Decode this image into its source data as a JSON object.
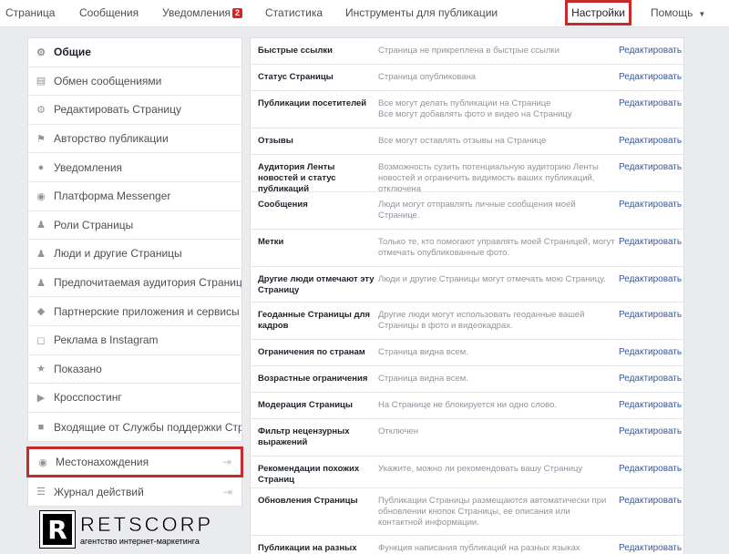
{
  "topbar": {
    "page": "Страница",
    "messages": "Сообщения",
    "notifications": "Уведомления",
    "notifications_count": "2",
    "stats": "Статистика",
    "tools": "Инструменты для публикации",
    "settings": "Настройки",
    "help": "Помощь"
  },
  "left_menu": [
    {
      "label": "Общие",
      "icon": "gear-icon"
    },
    {
      "label": "Обмен сообщениями",
      "icon": "messages-icon"
    },
    {
      "label": "Редактировать Страницу",
      "icon": "gear-icon"
    },
    {
      "label": "Авторство публикации",
      "icon": "flag-icon"
    },
    {
      "label": "Уведомления",
      "icon": "globe-icon"
    },
    {
      "label": "Платформа Messenger",
      "icon": "messenger-icon"
    },
    {
      "label": "Роли Страницы",
      "icon": "person-icon"
    },
    {
      "label": "Люди и другие Страницы",
      "icon": "people-icon"
    },
    {
      "label": "Предпочитаемая аудитория Страницы",
      "icon": "people-icon"
    },
    {
      "label": "Партнерские приложения и сервисы",
      "icon": "cube-icon"
    },
    {
      "label": "Реклама в Instagram",
      "icon": "instagram-icon"
    },
    {
      "label": "Показано",
      "icon": "star-icon"
    },
    {
      "label": "Кросспостинг",
      "icon": "video-icon"
    },
    {
      "label": "Входящие от Службы поддержки Страни",
      "icon": "facebook-icon"
    }
  ],
  "left_menu2": [
    {
      "label": "Местонахождения",
      "icon": "pin-icon"
    },
    {
      "label": "Журнал действий",
      "icon": "list-icon"
    }
  ],
  "settings_rows": [
    {
      "label": "Быстрые ссылки",
      "value": "Страница не прикреплена в быстрые ссылки",
      "edit": "Редактировать"
    },
    {
      "label": "Статус Страницы",
      "value": "Страница опубликована",
      "edit": "Редактировать"
    },
    {
      "label": "Публикации посетителей",
      "value": "Все могут делать публикации на Странице\nВсе могут добавлять фото и видео на Страницу",
      "edit": "Редактировать"
    },
    {
      "label": "Отзывы",
      "value": "Все могут оставлять отзывы на Странице",
      "edit": "Редактировать"
    },
    {
      "label": "Аудитория Ленты новостей и статус публикаций",
      "value": "Возможность сузить потенциальную аудиторию Ленты новостей и ограничить видимость ваших публикаций, отключена",
      "edit": "Редактировать"
    },
    {
      "label": "Сообщения",
      "value": "Люди могут отправлять личные сообщения моей Странице.",
      "edit": "Редактировать"
    },
    {
      "label": "Метки",
      "value": "Только те, кто помогают управлять моей Страницей, могут отмечать опубликованные фото.",
      "edit": "Редактировать"
    },
    {
      "label": "Другие люди отмечают эту Страницу",
      "value": "Люди и другие Страницы могут отмечать мою Страницу.",
      "edit": "Редактировать"
    },
    {
      "label": "Геоданные Страницы для кадров",
      "value": "Другие люди могут использовать геоданные вашей Страницы в фото и видеокадрах.",
      "edit": "Редактировать"
    },
    {
      "label": "Ограничения по странам",
      "value": "Страница видна всем.",
      "edit": "Редактировать"
    },
    {
      "label": "Возрастные ограничения",
      "value": "Страница видна всем.",
      "edit": "Редактировать"
    },
    {
      "label": "Модерация Страницы",
      "value": "На Странице не блокируется ни одно слово.",
      "edit": "Редактировать"
    },
    {
      "label": "Фильтр нецензурных выражений",
      "value": "Отключен",
      "edit": "Редактировать"
    },
    {
      "label": "Рекомендации похожих Страниц",
      "value": "Укажите, можно ли рекомендовать вашу Страницу",
      "edit": "Редактировать"
    },
    {
      "label": "Обновления Страницы",
      "value": "Публикации Страницы размещаются автоматически при обновлении кнопок Страницы, ее описания или контактной информации.",
      "edit": "Редактировать"
    },
    {
      "label": "Публикации на разных",
      "value": "Функция написания публикаций на разных языках",
      "edit": "Редактировать"
    }
  ],
  "watermark": {
    "letter": "R",
    "name": "RETSCORP",
    "tagline": "агентство интернет-маркетинга"
  },
  "colors": {
    "link": "#365899",
    "highlight_border": "#c62b2b",
    "badge": "#e02020",
    "background": "#e9ebee"
  }
}
